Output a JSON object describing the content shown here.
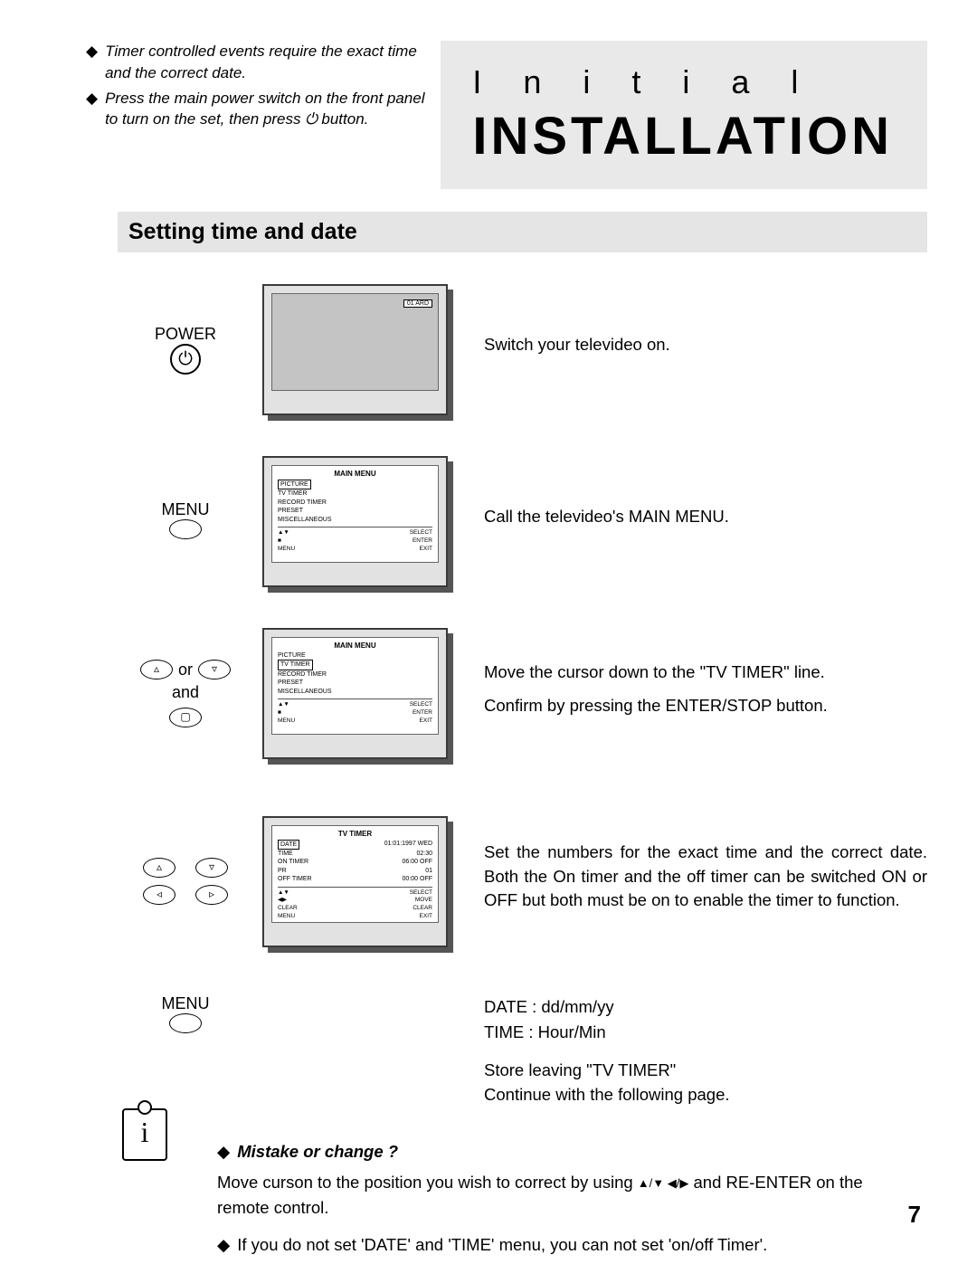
{
  "header": {
    "title_spaced": "Initial",
    "title_main": "INSTALLATION"
  },
  "notes": [
    "Timer controlled events require the exact time and the correct date.",
    "Press the main power switch on the front panel to turn on the set, then press ⏻ button."
  ],
  "section_title": "Setting time and date",
  "steps": {
    "power": {
      "label": "POWER",
      "desc": "Switch your televideo on.",
      "screen_tag": "01 ARD"
    },
    "menu": {
      "label": "MENU",
      "desc": "Call the televideo's MAIN MENU.",
      "screen_title": "MAIN MENU",
      "items": [
        "PICTURE",
        "TV TIMER",
        "RECORD TIMER",
        "PRESET",
        "MISCELLANEOUS"
      ],
      "selected": "PICTURE",
      "footer": [
        [
          "▲▼",
          "SELECT"
        ],
        [
          "■",
          "ENTER"
        ],
        [
          "MENU",
          "EXIT"
        ]
      ]
    },
    "nav": {
      "label_or": "or",
      "label_and": "and",
      "desc1": "Move the cursor down to the \"TV TIMER\" line.",
      "desc2": "Confirm by pressing the ENTER/STOP button.",
      "screen_title": "MAIN MENU",
      "items": [
        "PICTURE",
        "TV TIMER",
        "RECORD TIMER",
        "PRESET",
        "MISCELLANEOUS"
      ],
      "selected": "TV TIMER",
      "footer": [
        [
          "▲▼",
          "SELECT"
        ],
        [
          "■",
          "ENTER"
        ],
        [
          "MENU",
          "EXIT"
        ]
      ]
    },
    "timer": {
      "desc": "Set the numbers for the exact time and the correct date. Both the On timer and the off timer can be switched ON or OFF but both must be on to enable the timer to function.",
      "screen_title": "TV TIMER",
      "rows": [
        [
          "DATE",
          "01:01:1997 WED"
        ],
        [
          "TIME",
          "02:30"
        ],
        [
          "ON TIMER",
          "06:00 OFF"
        ],
        [
          "PR",
          "01"
        ],
        [
          "OFF TIMER",
          "00:00 OFF"
        ]
      ],
      "selected": "DATE",
      "footer": [
        [
          "▲▼",
          "SELECT"
        ],
        [
          "◀▶",
          "MOVE"
        ],
        [
          "CLEAR",
          "CLEAR"
        ],
        [
          "MENU",
          "EXIT"
        ]
      ]
    }
  },
  "format_hints": {
    "label": "MENU",
    "date": "DATE : dd/mm/yy",
    "time": "TIME : Hour/Min",
    "store": "Store leaving \"TV TIMER\"",
    "cont": "Continue with the following page."
  },
  "footer_notes": {
    "heading": "Mistake or change ?",
    "p1a": "Move curson to the position you wish to correct by using ",
    "p1b": " and RE-ENTER on the remote control.",
    "arrows": "▲/▼ ◀/▶",
    "p2": "If you do not set 'DATE' and 'TIME' menu, you can not set 'on/off Timer'."
  },
  "page_number": "7"
}
